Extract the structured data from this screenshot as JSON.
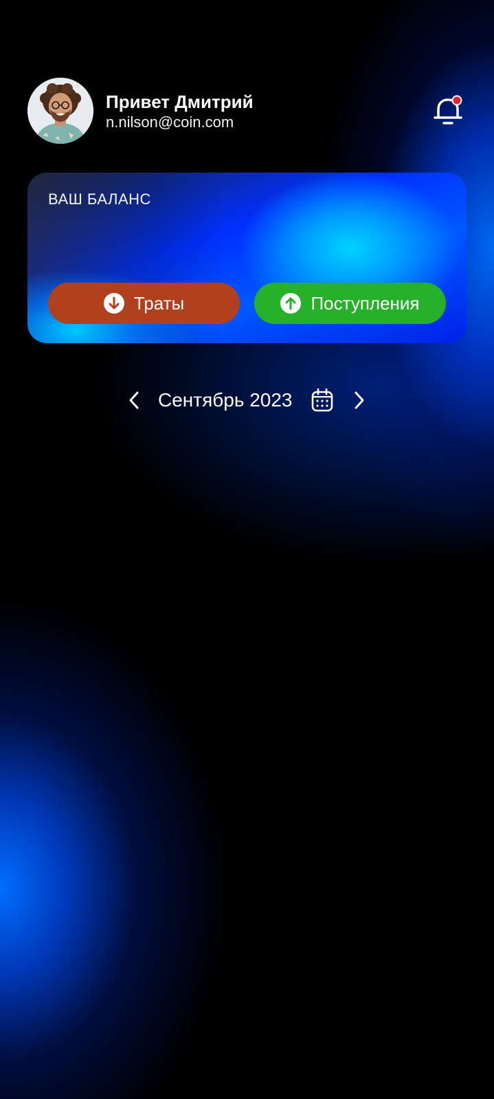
{
  "user": {
    "greeting": "Привет Дмитрий",
    "email": "n.nilson@coin.com",
    "avatar": "profile-photo-curly-hair-glasses"
  },
  "notifications": {
    "icon": "bell-icon",
    "has_unread": true,
    "badge_color": "#e8212e"
  },
  "balance_card": {
    "label": "ВАШ БАЛАНС",
    "spend_button": {
      "label": "Траты",
      "icon": "arrow-down-circle-icon",
      "color": "#b1401e"
    },
    "income_button": {
      "label": "Поступления",
      "icon": "arrow-up-circle-icon",
      "color": "#27b12a"
    }
  },
  "period": {
    "label": "Сентябрь 2023",
    "prev_icon": "chevron-left-icon",
    "next_icon": "chevron-right-icon",
    "calendar_icon": "calendar-icon"
  }
}
